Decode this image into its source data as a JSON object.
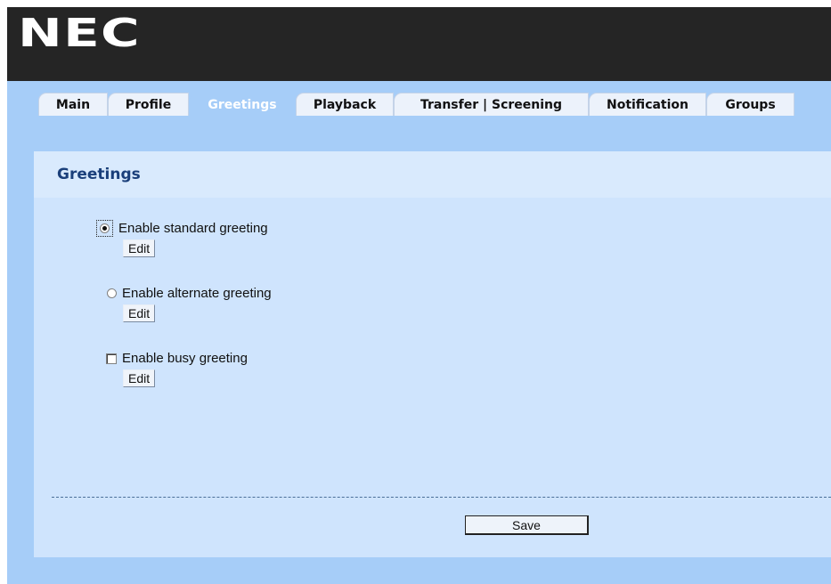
{
  "brand": {
    "logo_text": "NEC"
  },
  "tabs": [
    {
      "label": "Main",
      "active": false
    },
    {
      "label": "Profile",
      "active": false
    },
    {
      "label": "Greetings",
      "active": true
    },
    {
      "label": "Playback",
      "active": false
    },
    {
      "label": "Transfer | Screening",
      "active": false
    },
    {
      "label": "Notification",
      "active": false
    },
    {
      "label": "Groups",
      "active": false
    }
  ],
  "greetings": {
    "title": "Greetings",
    "options": [
      {
        "type": "radio",
        "label": "Enable standard greeting",
        "checked": true,
        "edit_label": "Edit"
      },
      {
        "type": "radio",
        "label": "Enable alternate greeting",
        "checked": false,
        "edit_label": "Edit"
      },
      {
        "type": "checkbox",
        "label": "Enable busy greeting",
        "checked": false,
        "edit_label": "Edit"
      }
    ],
    "save_label": "Save"
  },
  "colors": {
    "header_bg": "#252525",
    "page_bg": "#a6cdf8",
    "panel_bg": "#cfe4fd",
    "title_color": "#1a3f7a"
  }
}
